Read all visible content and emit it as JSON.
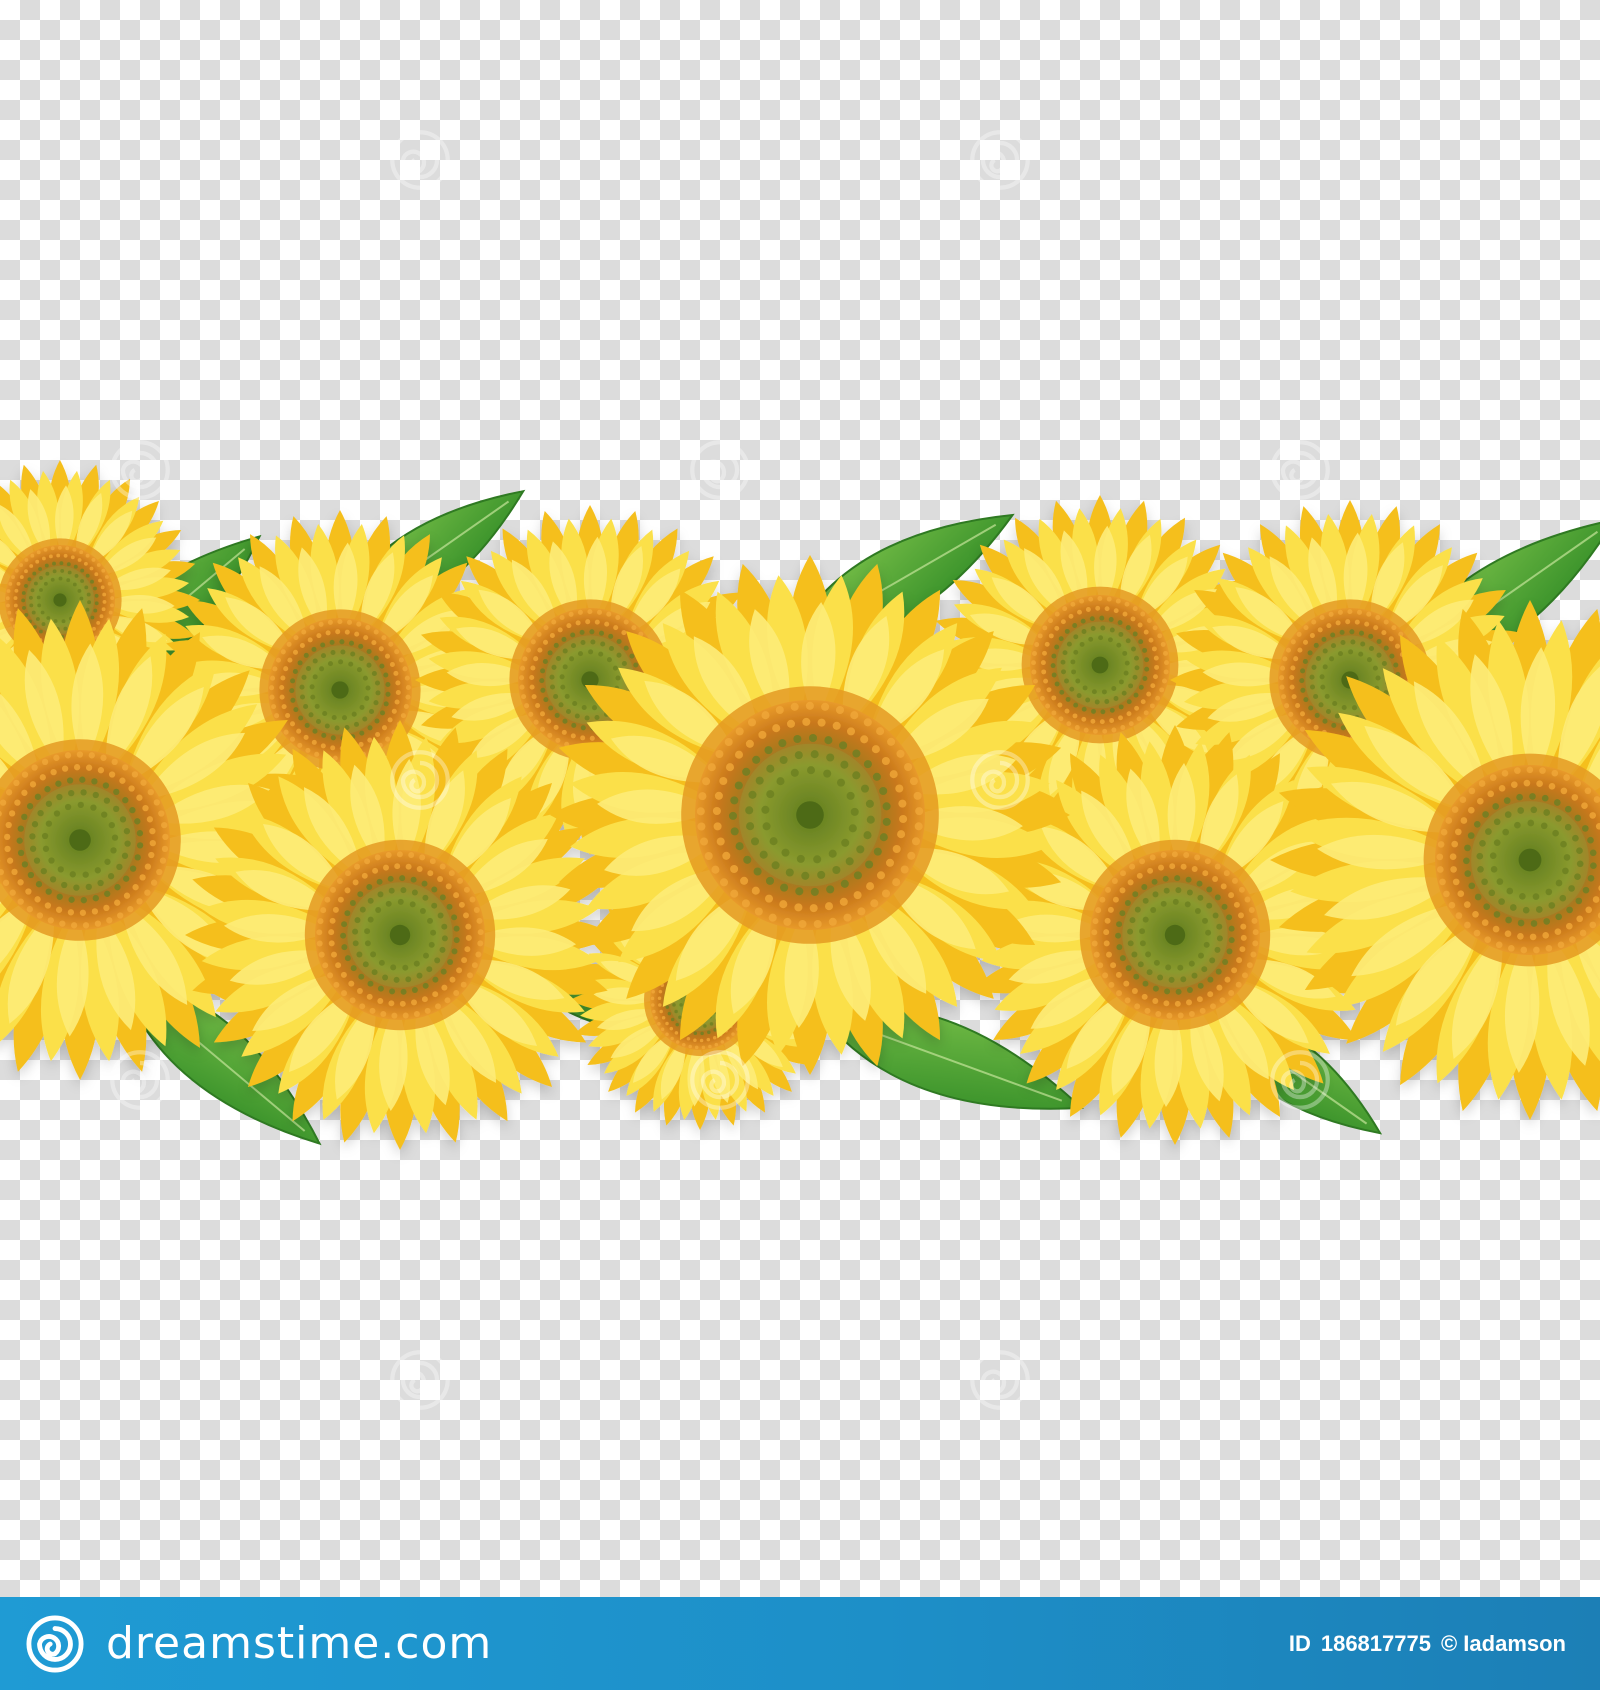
{
  "image": {
    "subject": "horizontal garland of sunflowers with green leaves on a transparent checkerboard background",
    "colors": {
      "petal_light": "#fbe85a",
      "petal_dark": "#f4b91c",
      "center_ring": "#d9851c",
      "center_core": "#7f8f2c",
      "leaf": "#3e9a2e",
      "footer_blue": "#1d8fc8"
    }
  },
  "footer": {
    "brand": "dreamstime.com",
    "id_label": "ID",
    "id_value": "186817775",
    "copyright": "© Iadamson"
  },
  "icons": {
    "brand_logo": "swirl-icon",
    "watermark": "swirl-watermark-icon"
  }
}
